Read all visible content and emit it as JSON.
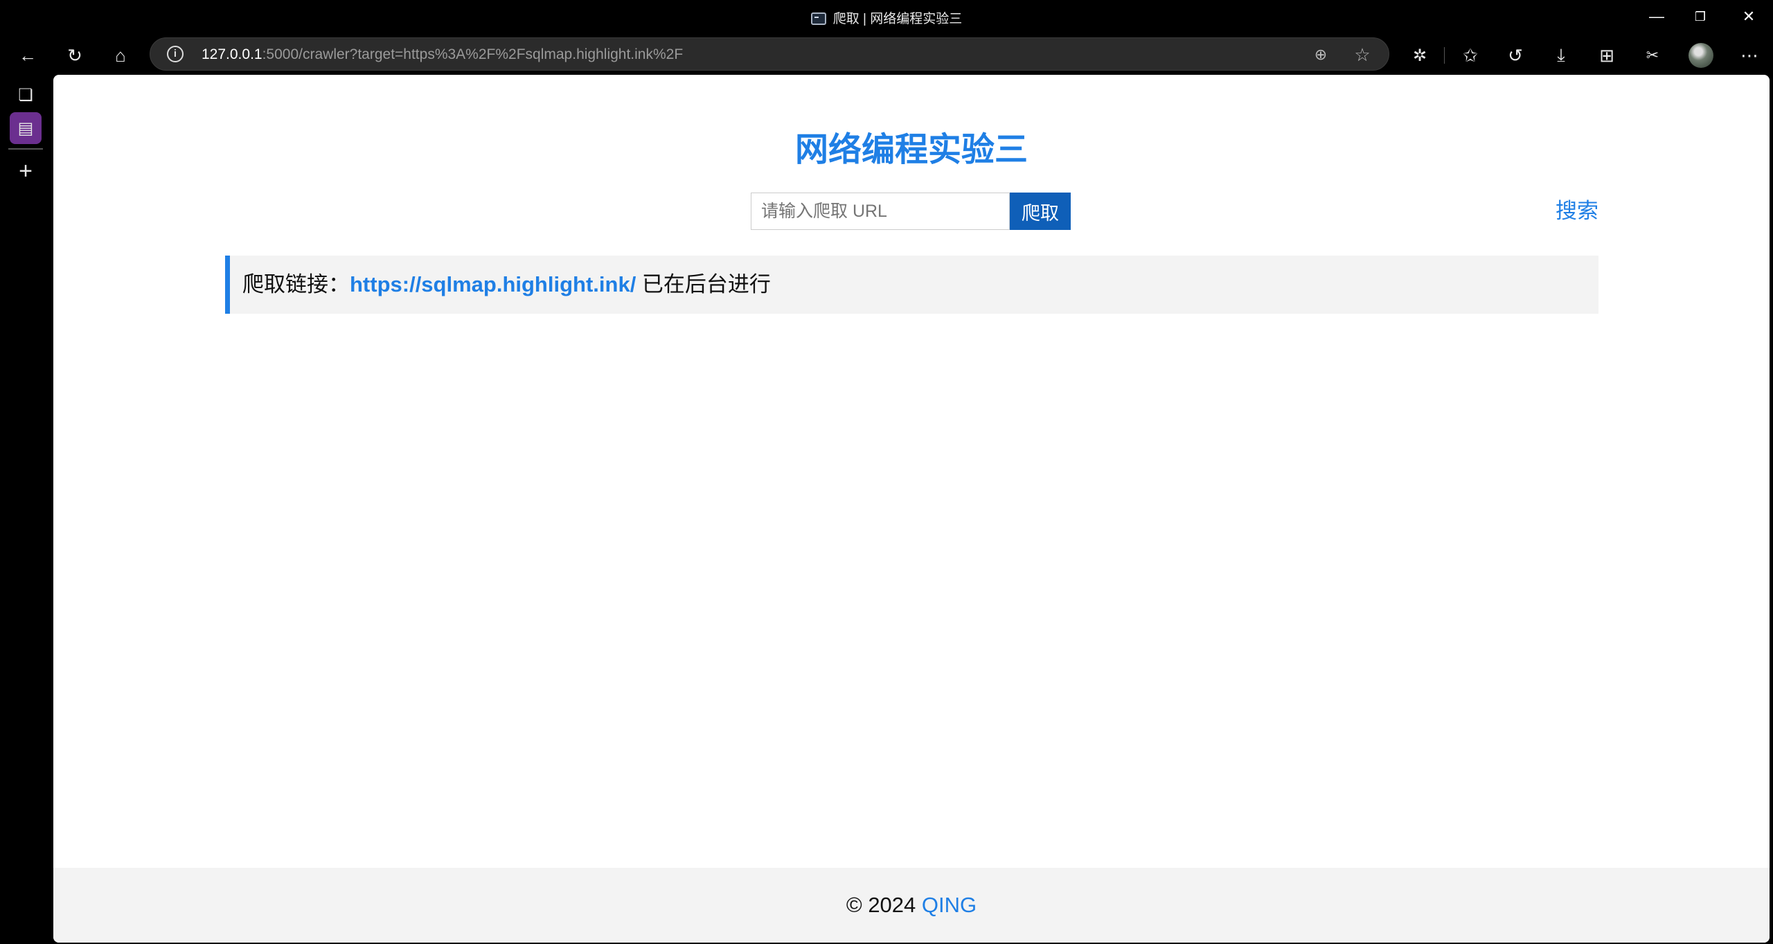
{
  "window": {
    "title": "爬取 | 网络编程实验三",
    "minimize_glyph": "—",
    "restore_glyph": "❐",
    "close_glyph": "✕"
  },
  "toolbar": {
    "back_glyph": "←",
    "refresh_glyph": "↻",
    "home_glyph": "⌂",
    "url_host": "127.0.0.1",
    "url_rest": ":5000/crawler?target=https%3A%2F%2Fsqlmap.highlight.ink%2F",
    "info_glyph": "i",
    "zoom_glyph": "⊕",
    "favorite_glyph": "☆",
    "extensions_glyph": "✲",
    "favorites_glyph": "✩",
    "history_glyph": "↺",
    "downloads_glyph": "⤓",
    "collections_glyph": "⊞",
    "screenshot_glyph": "✂",
    "more_glyph": "⋯"
  },
  "sidebar": {
    "tab_actions_glyph": "❏",
    "active_tab_glyph": "▤",
    "new_tab_glyph": "+"
  },
  "page": {
    "heading": "网络编程实验三",
    "url_placeholder": "请输入爬取 URL",
    "crawl_button": "爬取",
    "search_link": "搜索",
    "status_prefix": "爬取链接：",
    "status_link": "https://sqlmap.highlight.ink/",
    "status_suffix": " 已在后台进行",
    "footer_prefix": "© 2024 ",
    "footer_link": "QING"
  },
  "colors": {
    "accent": "#1f7fe5",
    "button_bg": "#0f5fb8",
    "panel_bg": "#f3f3f3",
    "sidebar_active": "#6b2f8f"
  }
}
